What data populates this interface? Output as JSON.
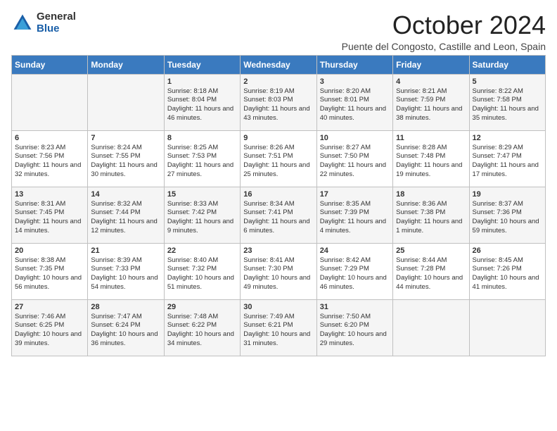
{
  "logo": {
    "general": "General",
    "blue": "Blue"
  },
  "title": "October 2024",
  "location": "Puente del Congosto, Castille and Leon, Spain",
  "weekdays": [
    "Sunday",
    "Monday",
    "Tuesday",
    "Wednesday",
    "Thursday",
    "Friday",
    "Saturday"
  ],
  "weeks": [
    [
      {
        "day": "",
        "sunrise": "",
        "sunset": "",
        "daylight": ""
      },
      {
        "day": "",
        "sunrise": "",
        "sunset": "",
        "daylight": ""
      },
      {
        "day": "1",
        "sunrise": "Sunrise: 8:18 AM",
        "sunset": "Sunset: 8:04 PM",
        "daylight": "Daylight: 11 hours and 46 minutes."
      },
      {
        "day": "2",
        "sunrise": "Sunrise: 8:19 AM",
        "sunset": "Sunset: 8:03 PM",
        "daylight": "Daylight: 11 hours and 43 minutes."
      },
      {
        "day": "3",
        "sunrise": "Sunrise: 8:20 AM",
        "sunset": "Sunset: 8:01 PM",
        "daylight": "Daylight: 11 hours and 40 minutes."
      },
      {
        "day": "4",
        "sunrise": "Sunrise: 8:21 AM",
        "sunset": "Sunset: 7:59 PM",
        "daylight": "Daylight: 11 hours and 38 minutes."
      },
      {
        "day": "5",
        "sunrise": "Sunrise: 8:22 AM",
        "sunset": "Sunset: 7:58 PM",
        "daylight": "Daylight: 11 hours and 35 minutes."
      }
    ],
    [
      {
        "day": "6",
        "sunrise": "Sunrise: 8:23 AM",
        "sunset": "Sunset: 7:56 PM",
        "daylight": "Daylight: 11 hours and 32 minutes."
      },
      {
        "day": "7",
        "sunrise": "Sunrise: 8:24 AM",
        "sunset": "Sunset: 7:55 PM",
        "daylight": "Daylight: 11 hours and 30 minutes."
      },
      {
        "day": "8",
        "sunrise": "Sunrise: 8:25 AM",
        "sunset": "Sunset: 7:53 PM",
        "daylight": "Daylight: 11 hours and 27 minutes."
      },
      {
        "day": "9",
        "sunrise": "Sunrise: 8:26 AM",
        "sunset": "Sunset: 7:51 PM",
        "daylight": "Daylight: 11 hours and 25 minutes."
      },
      {
        "day": "10",
        "sunrise": "Sunrise: 8:27 AM",
        "sunset": "Sunset: 7:50 PM",
        "daylight": "Daylight: 11 hours and 22 minutes."
      },
      {
        "day": "11",
        "sunrise": "Sunrise: 8:28 AM",
        "sunset": "Sunset: 7:48 PM",
        "daylight": "Daylight: 11 hours and 19 minutes."
      },
      {
        "day": "12",
        "sunrise": "Sunrise: 8:29 AM",
        "sunset": "Sunset: 7:47 PM",
        "daylight": "Daylight: 11 hours and 17 minutes."
      }
    ],
    [
      {
        "day": "13",
        "sunrise": "Sunrise: 8:31 AM",
        "sunset": "Sunset: 7:45 PM",
        "daylight": "Daylight: 11 hours and 14 minutes."
      },
      {
        "day": "14",
        "sunrise": "Sunrise: 8:32 AM",
        "sunset": "Sunset: 7:44 PM",
        "daylight": "Daylight: 11 hours and 12 minutes."
      },
      {
        "day": "15",
        "sunrise": "Sunrise: 8:33 AM",
        "sunset": "Sunset: 7:42 PM",
        "daylight": "Daylight: 11 hours and 9 minutes."
      },
      {
        "day": "16",
        "sunrise": "Sunrise: 8:34 AM",
        "sunset": "Sunset: 7:41 PM",
        "daylight": "Daylight: 11 hours and 6 minutes."
      },
      {
        "day": "17",
        "sunrise": "Sunrise: 8:35 AM",
        "sunset": "Sunset: 7:39 PM",
        "daylight": "Daylight: 11 hours and 4 minutes."
      },
      {
        "day": "18",
        "sunrise": "Sunrise: 8:36 AM",
        "sunset": "Sunset: 7:38 PM",
        "daylight": "Daylight: 11 hours and 1 minute."
      },
      {
        "day": "19",
        "sunrise": "Sunrise: 8:37 AM",
        "sunset": "Sunset: 7:36 PM",
        "daylight": "Daylight: 10 hours and 59 minutes."
      }
    ],
    [
      {
        "day": "20",
        "sunrise": "Sunrise: 8:38 AM",
        "sunset": "Sunset: 7:35 PM",
        "daylight": "Daylight: 10 hours and 56 minutes."
      },
      {
        "day": "21",
        "sunrise": "Sunrise: 8:39 AM",
        "sunset": "Sunset: 7:33 PM",
        "daylight": "Daylight: 10 hours and 54 minutes."
      },
      {
        "day": "22",
        "sunrise": "Sunrise: 8:40 AM",
        "sunset": "Sunset: 7:32 PM",
        "daylight": "Daylight: 10 hours and 51 minutes."
      },
      {
        "day": "23",
        "sunrise": "Sunrise: 8:41 AM",
        "sunset": "Sunset: 7:30 PM",
        "daylight": "Daylight: 10 hours and 49 minutes."
      },
      {
        "day": "24",
        "sunrise": "Sunrise: 8:42 AM",
        "sunset": "Sunset: 7:29 PM",
        "daylight": "Daylight: 10 hours and 46 minutes."
      },
      {
        "day": "25",
        "sunrise": "Sunrise: 8:44 AM",
        "sunset": "Sunset: 7:28 PM",
        "daylight": "Daylight: 10 hours and 44 minutes."
      },
      {
        "day": "26",
        "sunrise": "Sunrise: 8:45 AM",
        "sunset": "Sunset: 7:26 PM",
        "daylight": "Daylight: 10 hours and 41 minutes."
      }
    ],
    [
      {
        "day": "27",
        "sunrise": "Sunrise: 7:46 AM",
        "sunset": "Sunset: 6:25 PM",
        "daylight": "Daylight: 10 hours and 39 minutes."
      },
      {
        "day": "28",
        "sunrise": "Sunrise: 7:47 AM",
        "sunset": "Sunset: 6:24 PM",
        "daylight": "Daylight: 10 hours and 36 minutes."
      },
      {
        "day": "29",
        "sunrise": "Sunrise: 7:48 AM",
        "sunset": "Sunset: 6:22 PM",
        "daylight": "Daylight: 10 hours and 34 minutes."
      },
      {
        "day": "30",
        "sunrise": "Sunrise: 7:49 AM",
        "sunset": "Sunset: 6:21 PM",
        "daylight": "Daylight: 10 hours and 31 minutes."
      },
      {
        "day": "31",
        "sunrise": "Sunrise: 7:50 AM",
        "sunset": "Sunset: 6:20 PM",
        "daylight": "Daylight: 10 hours and 29 minutes."
      },
      {
        "day": "",
        "sunrise": "",
        "sunset": "",
        "daylight": ""
      },
      {
        "day": "",
        "sunrise": "",
        "sunset": "",
        "daylight": ""
      }
    ]
  ]
}
